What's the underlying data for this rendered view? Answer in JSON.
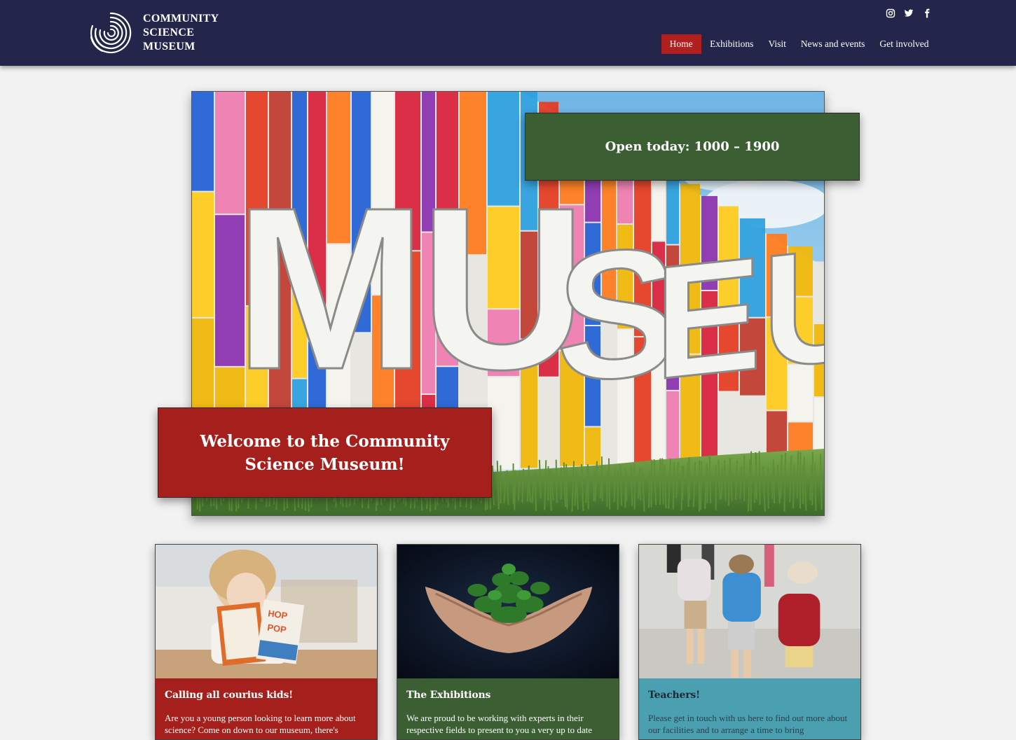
{
  "brand": {
    "name_lines": [
      "COMMUNITY",
      "SCIENCE",
      "MUSEUM"
    ]
  },
  "social": [
    "instagram-icon",
    "twitter-icon",
    "facebook-icon"
  ],
  "nav": {
    "items": [
      {
        "label": "Home",
        "active": true
      },
      {
        "label": "Exhibitions",
        "active": false
      },
      {
        "label": "Visit",
        "active": false
      },
      {
        "label": "News and events",
        "active": false
      },
      {
        "label": "Get involved",
        "active": false
      }
    ]
  },
  "hero": {
    "opening_hours": "Open today: 1000 – 1900",
    "welcome": "Welcome to the Community Science Museum!"
  },
  "cards": [
    {
      "title": "Calling all courius kids!",
      "text": "Are you a young person looking to learn more about science? Come on down to our museum, there's"
    },
    {
      "title": "The Exhibitions",
      "text": "We are proud to be working with experts in their respective fields to present to you a very up to date"
    },
    {
      "title": "Teachers!",
      "text": "Please get in touch with us here to find out more about our facilities and to arrange a time to bring"
    }
  ],
  "colors": {
    "header_bg": "#23264a",
    "accent_red": "#a51f1c",
    "accent_green": "#3b5f33",
    "accent_teal": "#4aa0b0",
    "page_bg": "#f2f2f2"
  }
}
